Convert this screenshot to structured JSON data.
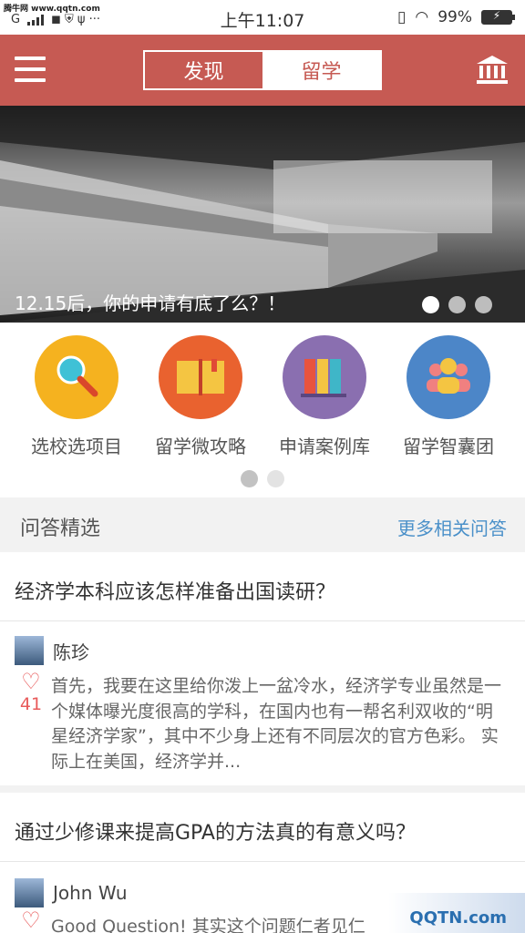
{
  "status_bar": {
    "watermark": "腾牛网 www.qqtn.com",
    "carrier": "G",
    "time": "上午11:07",
    "battery": "99%"
  },
  "header": {
    "tabs": [
      {
        "label": "发现",
        "active": false
      },
      {
        "label": "留学",
        "active": true
      }
    ],
    "accent_color": "#c65a53",
    "left_icon": "menu-icon",
    "right_icon": "bank-icon"
  },
  "banner": {
    "caption": "12.15后，你的申请有底了么？！",
    "page_count": 3,
    "active_page": 1
  },
  "quick_links": [
    {
      "label": "选校选项目",
      "icon": "search-icon",
      "color": "#f5b21f"
    },
    {
      "label": "留学微攻略",
      "icon": "book-icon",
      "color": "#e9622f"
    },
    {
      "label": "申请案例库",
      "icon": "binders-icon",
      "color": "#8a6fb0"
    },
    {
      "label": "留学智囊团",
      "icon": "group-icon",
      "color": "#4c86c8"
    }
  ],
  "quick_pages": {
    "count": 2,
    "active": 1
  },
  "qa_section": {
    "title": "问答精选",
    "more_link": "更多相关问答"
  },
  "questions": [
    {
      "title": "经济学本科应该怎样准备出国读研？",
      "author": "陈珍",
      "likes": "41",
      "excerpt": "首先，我要在这里给你泼上一盆冷水，经济学专业虽然是一个媒体曝光度很高的学科，在国内也有一帮名利双收的“明星经济学家”，其中不少身上还有不同层次的官方色彩。 实际上在美国，经济学并..."
    },
    {
      "title": "通过少修课来提高GPA的方法真的有意义吗？",
      "author": "John Wu",
      "likes": "",
      "excerpt": "Good Question! 其实这个问题仁者见仁"
    }
  ],
  "corner_watermark": "QQTN.com"
}
